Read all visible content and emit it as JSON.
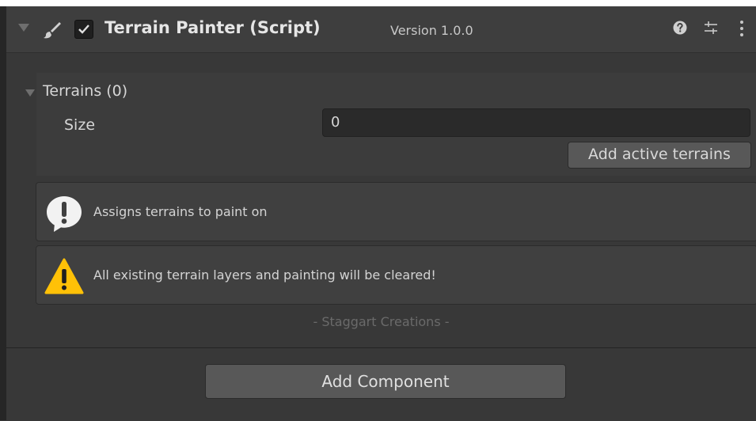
{
  "component": {
    "title": "Terrain Painter (Script)",
    "version": "Version 1.0.0",
    "enabled": true,
    "icons": [
      "brush-icon",
      "help-icon",
      "preset-icon",
      "kebab-menu-icon"
    ]
  },
  "terrains": {
    "label": "Terrains (0)",
    "size_label": "Size",
    "size_value": "0",
    "add_button_label": "Add active terrains"
  },
  "help_boxes": {
    "info_text": "Assigns terrains to paint on",
    "warning_text": "All existing terrain layers and painting will be cleared!"
  },
  "footer": {
    "credit": "- Staggart Creations -"
  },
  "add_component": {
    "label": "Add Component"
  },
  "colors": {
    "background": "#383838",
    "header": "#3e3e3e",
    "warning": "#ffc107",
    "info_icon": "#f2f2f2"
  }
}
